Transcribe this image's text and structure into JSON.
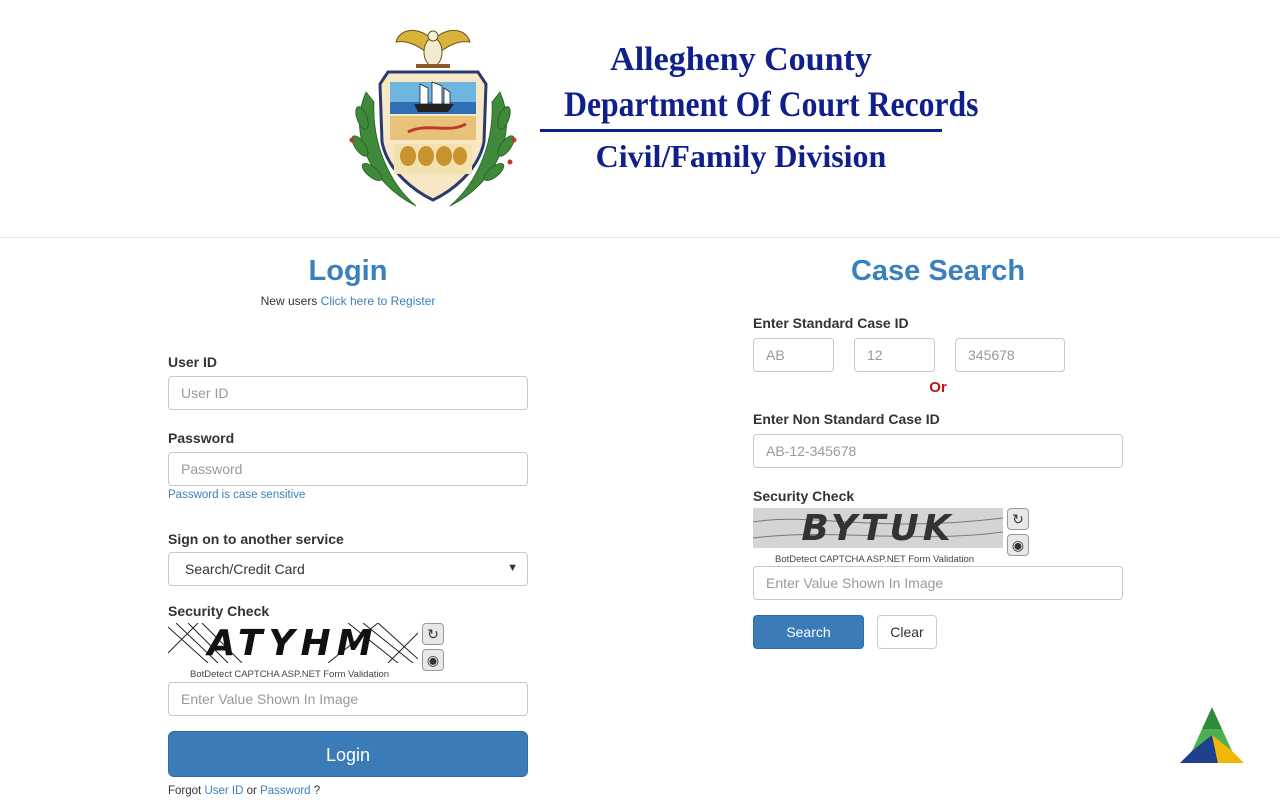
{
  "header": {
    "line1": "Allegheny County",
    "line2": "Department Of Court Records",
    "line3": "Civil/Family Division"
  },
  "login": {
    "title": "Login",
    "new_users_prefix": "New users",
    "register_link": "Click here to Register",
    "user_id_label": "User ID",
    "user_id_placeholder": "User ID",
    "password_label": "Password",
    "password_placeholder": "Password",
    "password_hint": "Password is case sensitive",
    "service_label": "Sign on to another service",
    "service_selected": "Search/Credit Card",
    "security_label": "Security Check",
    "captcha_text": "ATYHM",
    "captcha_note": "BotDetect CAPTCHA ASP.NET Form Validation",
    "captcha_placeholder": "Enter Value Shown In Image",
    "login_button": "Login",
    "forgot_prefix": "Forgot",
    "forgot_user_id": "User ID",
    "forgot_or": "or",
    "forgot_password": "Password",
    "forgot_suffix": "?"
  },
  "case_search": {
    "title": "Case Search",
    "standard_label": "Enter Standard Case ID",
    "part1_placeholder": "AB",
    "part2_placeholder": "12",
    "part3_placeholder": "345678",
    "or_text": "Or",
    "nonstandard_label": "Enter Non Standard Case ID",
    "nonstandard_placeholder": "AB-12-345678",
    "security_label": "Security Check",
    "captcha_text": "BYTUK",
    "captcha_note": "BotDetect CAPTCHA ASP.NET Form Validation",
    "captcha_placeholder": "Enter Value Shown In Image",
    "search_button": "Search",
    "clear_button": "Clear"
  },
  "icons": {
    "reload": "reload-icon",
    "sound": "speaker-icon",
    "chevron": "chevron-down-icon"
  },
  "colors": {
    "accent": "#3a80bd",
    "button": "#3a7bb8",
    "header_text": "#0f1f8c",
    "or_text": "#c0111a"
  }
}
